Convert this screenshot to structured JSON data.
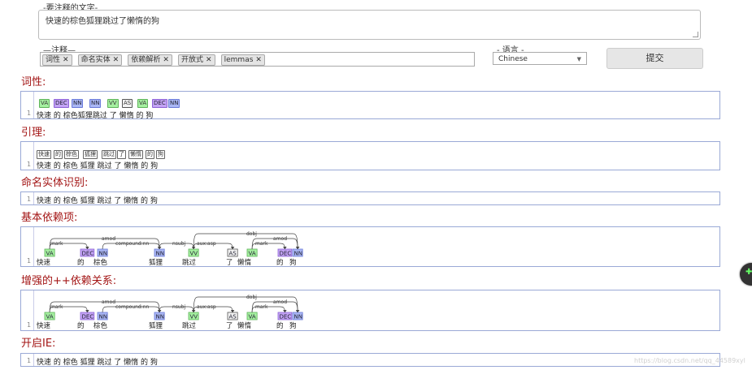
{
  "form": {
    "text_label": "-要注释的文字-",
    "text_value": "快速的棕色狐狸跳过了懒惰的狗",
    "annotators_label": "—注释—",
    "annotators": [
      "词性",
      "命名实体",
      "依赖解析",
      "开放式",
      "lemmas"
    ],
    "language_label": "- 语言 -",
    "language_value": "Chinese",
    "submit_label": "提交"
  },
  "sections": {
    "pos": {
      "title": "词性:",
      "line_no": "1",
      "tags": [
        "VA",
        "DEC",
        "NN",
        "NN",
        "VV",
        "AS",
        "VA",
        "DEC",
        "NN"
      ],
      "tokens": [
        "快速",
        "的",
        "棕色",
        "狐狸",
        "跳过",
        "了",
        "懒惰",
        "的",
        "狗"
      ]
    },
    "lemma": {
      "title": "引理:",
      "line_no": "1",
      "lemmas": [
        "快速",
        "的",
        "棕色",
        "狐狸",
        "跳过",
        "了",
        "懒惰",
        "的",
        "狗"
      ],
      "tokens": [
        "快速",
        "的",
        "棕色",
        "狐狸",
        "跳过",
        "了",
        "懒惰",
        "的",
        "狗"
      ]
    },
    "ner": {
      "title": "命名实体识别:",
      "line_no": "1",
      "text": "快速 的 棕色 狐狸 跳过 了 懒惰 的 狗"
    },
    "basic_dep": {
      "title": "基本依赖项:",
      "line_no": "1",
      "tags": [
        "VA",
        "DEC",
        "NN",
        "NN",
        "VV",
        "AS",
        "VA",
        "DEC",
        "NN"
      ],
      "tokens": [
        "快速",
        "的",
        "棕色",
        "狐狸",
        "跳过",
        "了",
        "懒惰",
        "的",
        "狗"
      ],
      "arcs": [
        "mark",
        "amod",
        "compound:nn",
        "nsubj",
        "aux:asp",
        "dobj",
        "mark",
        "amod"
      ]
    },
    "enh_dep": {
      "title": "增强的++依赖关系:",
      "line_no": "1",
      "tags": [
        "VA",
        "DEC",
        "NN",
        "NN",
        "VV",
        "AS",
        "VA",
        "DEC",
        "NN"
      ],
      "tokens": [
        "快速",
        "的",
        "棕色",
        "狐狸",
        "跳过",
        "了",
        "懒惰",
        "的",
        "狗"
      ],
      "arcs": [
        "mark",
        "amod",
        "compound:nn",
        "nsubj",
        "aux:asp",
        "dobj",
        "mark",
        "amod"
      ]
    },
    "openie": {
      "title": "开启IE:",
      "line_no": "1",
      "text": "快速 的 棕色 狐狸 跳过 了 懒惰 的 狗"
    }
  },
  "watermark": "https://blog.csdn.net/qq_44589xyl",
  "colors": {
    "title_red": "#a31515",
    "panel_border": "#9aa9d6",
    "tag_green": "#a5f0a0",
    "tag_blue": "#aab7f5",
    "tag_purple": "#c3a3f5"
  }
}
